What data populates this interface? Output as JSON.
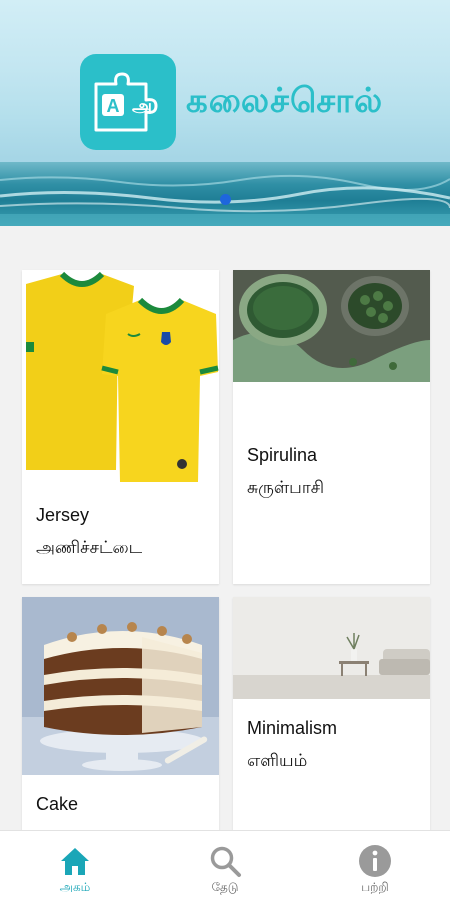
{
  "header": {
    "app_title": "கலைச்சொல்",
    "logo_letter_en": "A",
    "logo_letter_ta": "அ"
  },
  "carousel": {
    "active_index": 0,
    "dot_color": "#1e66dd"
  },
  "cards": [
    {
      "english": "Jersey",
      "tamil": "அணிச்சட்டை",
      "image": "yellow-jersey"
    },
    {
      "english": "Spirulina",
      "tamil": "சுருள்பாசி",
      "image": "spirulina-bowl"
    },
    {
      "english": "Cake",
      "tamil": "",
      "image": "carrot-cake"
    },
    {
      "english": "Minimalism",
      "tamil": "எளியம்",
      "image": "minimal-room"
    }
  ],
  "bottom_nav": {
    "items": [
      {
        "label": "அகம்",
        "icon": "home-icon",
        "active": true
      },
      {
        "label": "தேடு",
        "icon": "search-icon",
        "active": false
      },
      {
        "label": "பற்றி",
        "icon": "info-icon",
        "active": false
      }
    ]
  },
  "colors": {
    "accent": "#2bbfc9",
    "nav_active": "#1aa6b7",
    "nav_inactive": "#9a9a9a"
  }
}
